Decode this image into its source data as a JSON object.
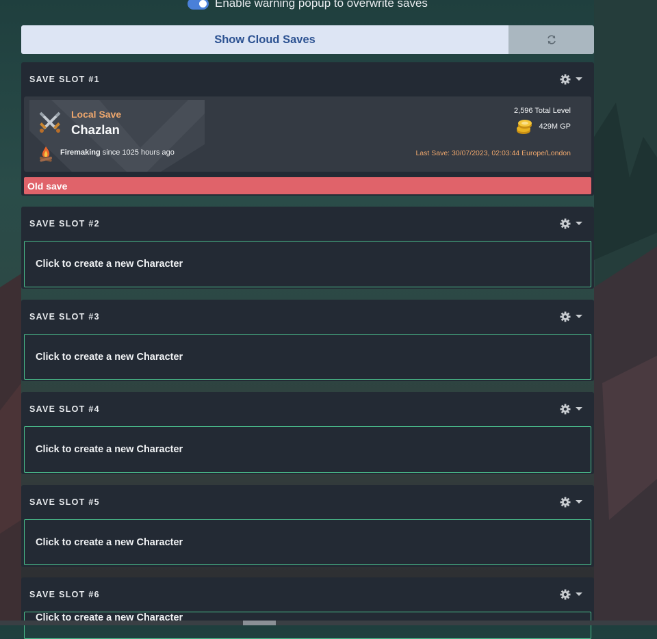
{
  "toggle": {
    "label": "Enable warning popup to overwrite saves",
    "enabled": true
  },
  "cloud": {
    "show_label": "Show Cloud Saves",
    "refresh_icon": "refresh-icon"
  },
  "slots": [
    {
      "title": "SAVE SLOT #1",
      "save_type": "Local Save",
      "character": "Chazlan",
      "total_level": "2,596 Total Level",
      "gp": "429M GP",
      "skill": "Firemaking",
      "since": "since 1025 hours ago",
      "last_save": "Last Save: 30/07/2023, 02:03:44 Europe/London",
      "status": "Old save"
    },
    {
      "title": "SAVE SLOT #2",
      "empty_label": "Click to create a new Character"
    },
    {
      "title": "SAVE SLOT #3",
      "empty_label": "Click to create a new Character"
    },
    {
      "title": "SAVE SLOT #4",
      "empty_label": "Click to create a new Character"
    },
    {
      "title": "SAVE SLOT #5",
      "empty_label": "Click to create a new Character"
    },
    {
      "title": "SAVE SLOT #6",
      "empty_label": "Click to create a new Character"
    }
  ],
  "colors": {
    "accent_orange": "#eea76d",
    "old_save_red": "#e0636a",
    "create_border_green": "#4bc28e",
    "cloud_button": "#dde5f4"
  }
}
